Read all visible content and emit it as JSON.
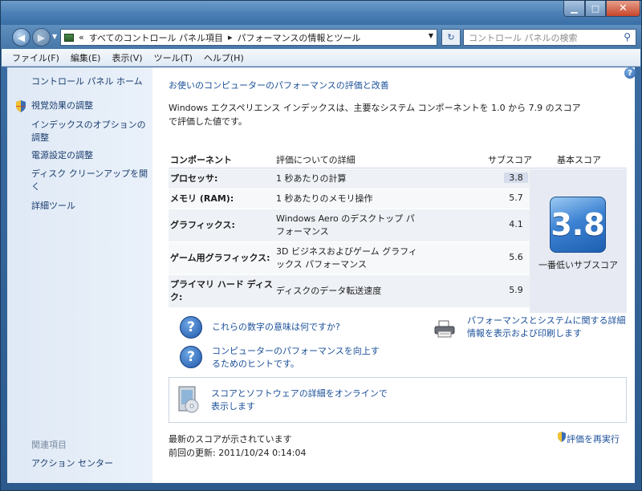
{
  "window": {
    "controls": {
      "min": "▁",
      "max": "□",
      "close": "✕"
    }
  },
  "address": {
    "prefix": "«",
    "crumb1": "すべてのコントロール パネル項目",
    "sep": "▸",
    "crumb2": "パフォーマンスの情報とツール"
  },
  "search": {
    "placeholder": "コントロール パネルの検索"
  },
  "menu": [
    "ファイル(F)",
    "編集(E)",
    "表示(V)",
    "ツール(T)",
    "ヘルプ(H)"
  ],
  "sidebar": {
    "home": "コントロール パネル ホーム",
    "items": [
      "視覚効果の調整",
      "インデックスのオプションの調整",
      "電源設定の調整",
      "ディスク クリーンアップを開く",
      "詳細ツール"
    ],
    "related_title": "関連項目",
    "related_item": "アクション センター"
  },
  "main": {
    "heading": "お使いのコンピューターのパフォーマンスの評価と改善",
    "intro": "Windows エクスペリエンス インデックスは、主要なシステム コンポーネントを 1.0 から 7.9 のスコアで評価した値です。",
    "table": {
      "headers": {
        "component": "コンポーネント",
        "details": "評価についての詳細",
        "subscore": "サブスコア",
        "base": "基本スコア"
      },
      "rows": [
        {
          "name": "プロセッサ:",
          "desc": "1 秒あたりの計算",
          "score": "3.8"
        },
        {
          "name": "メモリ (RAM):",
          "desc": "1 秒あたりのメモリ操作",
          "score": "5.7"
        },
        {
          "name": "グラフィックス:",
          "desc": "Windows Aero のデスクトップ パフォーマンス",
          "score": "4.1"
        },
        {
          "name": "ゲーム用グラフィックス:",
          "desc": "3D ビジネスおよびゲーム グラフィックス パフォーマンス",
          "score": "5.6"
        },
        {
          "name": "プライマリ ハード ディスク:",
          "desc": "ディスクのデータ転送速度",
          "score": "5.9"
        }
      ],
      "base_score": "3.8",
      "base_label": "一番低いサブスコア"
    },
    "links": {
      "meaning": "これらの数字の意味は何ですか?",
      "tips": "コンピューターのパフォーマンスを向上するためのヒントです。",
      "print": "パフォーマンスとシステムに関する詳細情報を表示および印刷します",
      "online": "スコアとソフトウェアの詳細をオンラインで表示します"
    },
    "status": {
      "current": "最新のスコアが示されています",
      "last_update": "前回の更新: 2011/10/24 0:14:04",
      "rerun": "評価を再実行"
    }
  }
}
